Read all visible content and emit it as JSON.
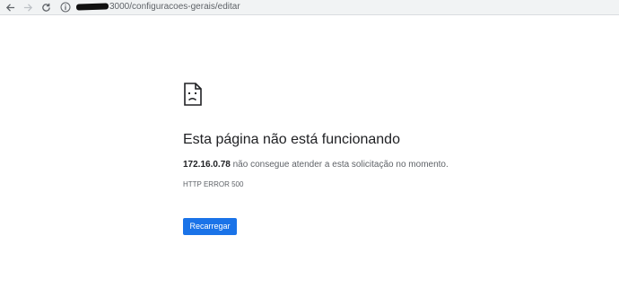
{
  "browser": {
    "url_suffix": "3000/configuracoes-gerais/editar",
    "icons": {
      "back": "arrow-left-icon",
      "forward": "arrow-right-icon",
      "reload": "reload-icon",
      "site_info": "info-icon"
    }
  },
  "error_page": {
    "icon": "sad-document-icon",
    "title": "Esta página não está funcionando",
    "host": "172.16.0.78",
    "message": " não consegue atender a esta solicitação no momento.",
    "code": "HTTP ERROR 500",
    "reload_label": "Recarregar",
    "accent_color": "#1a73e8"
  }
}
